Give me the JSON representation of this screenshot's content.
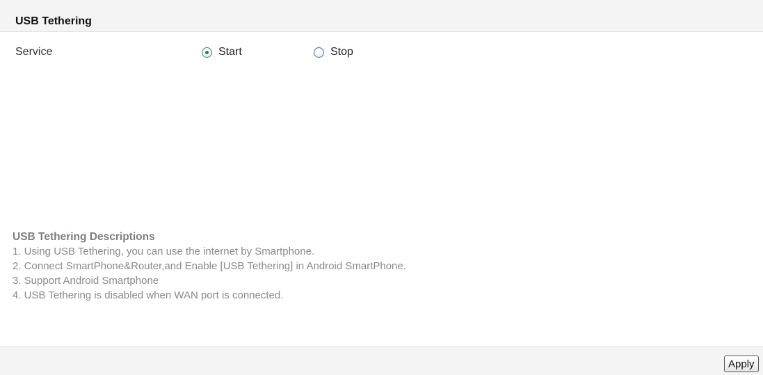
{
  "header": {
    "title": "USB Tethering"
  },
  "service": {
    "label": "Service",
    "options": [
      {
        "label": "Start",
        "selected": true
      },
      {
        "label": "Stop",
        "selected": false
      }
    ]
  },
  "descriptions": {
    "title": "USB Tethering Descriptions",
    "lines": [
      "1. Using USB Tethering, you can use the internet by Smartphone.",
      "2. Connect SmartPhone&Router,and Enable [USB Tethering] in Android SmartPhone.",
      "3. Support Android Smartphone",
      "4. USB Tethering is disabled when WAN port is connected."
    ]
  },
  "footer": {
    "apply_label": "Apply"
  },
  "colors": {
    "selected_dot": "#2a8a2a",
    "radio_border": "#4f6d8a",
    "bar_background": "#f4f4f4",
    "description_text": "#8a8a8a"
  }
}
